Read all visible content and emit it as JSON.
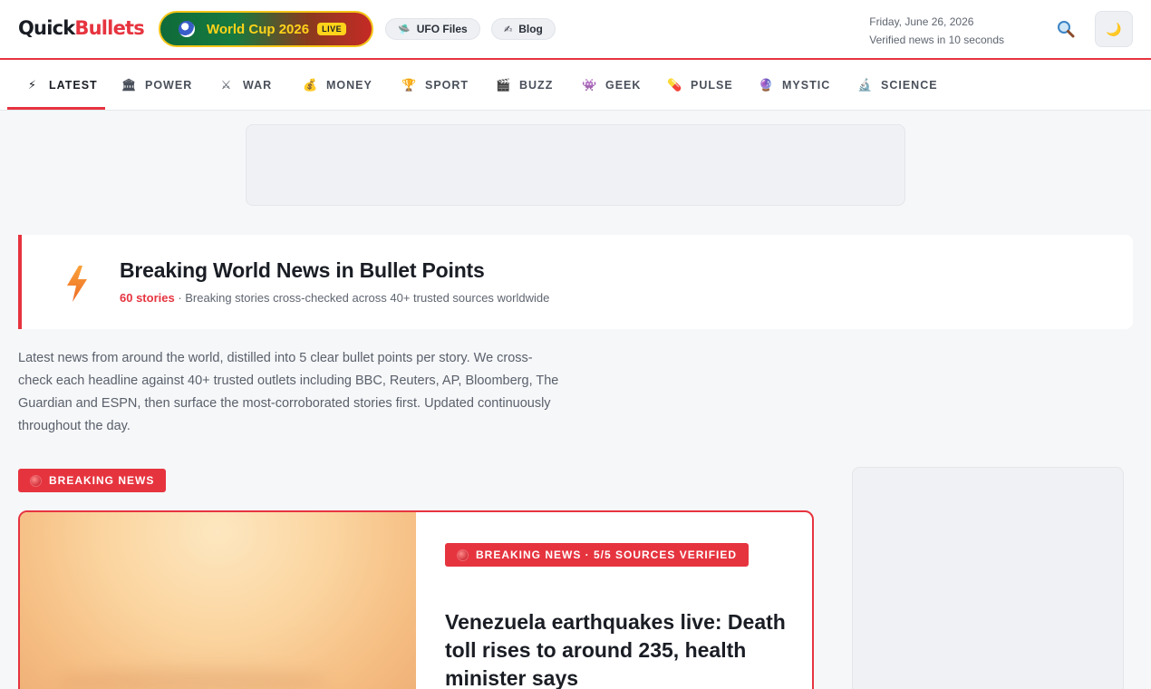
{
  "header": {
    "logo_part1": "Quick",
    "logo_part2": "Bullets",
    "world_cup": {
      "label": "World Cup 2026",
      "live": "LIVE"
    },
    "pills": [
      {
        "label": "UFO Files",
        "icon": "ufo-icon"
      },
      {
        "label": "Blog",
        "icon": "writing-hand-icon"
      }
    ],
    "date": "Friday, June 26, 2026",
    "tagline": "Verified news in 10 seconds",
    "search_icon": "search-icon",
    "theme_icon": "moon-icon"
  },
  "nav": {
    "items": [
      {
        "label": "LATEST",
        "icon": "⚡",
        "active": true
      },
      {
        "label": "POWER",
        "icon": "🏛"
      },
      {
        "label": "WAR",
        "icon": "⚔"
      },
      {
        "label": "MONEY",
        "icon": "💰"
      },
      {
        "label": "SPORT",
        "icon": "🏆"
      },
      {
        "label": "BUZZ",
        "icon": "🎬"
      },
      {
        "label": "GEEK",
        "icon": "👾"
      },
      {
        "label": "PULSE",
        "icon": "💊"
      },
      {
        "label": "MYSTIC",
        "icon": "🔮"
      },
      {
        "label": "SCIENCE",
        "icon": "🔬"
      }
    ]
  },
  "hero": {
    "title": "Breaking World News in Bullet Points",
    "count": "60 stories",
    "subtitle": " · Breaking stories cross-checked across 40+ trusted sources worldwide",
    "intro": "Latest news from around the world, distilled into 5 clear bullet points per story. We cross-check each headline against 40+ trusted outlets including BBC, Reuters, AP, Bloomberg, The Guardian and ESPN, then surface the most-corroborated stories first. Updated continuously throughout the day."
  },
  "breaking_label": "BREAKING NEWS",
  "story": {
    "badge": "BREAKING NEWS · 5/5 SOURCES VERIFIED",
    "headline": "Venezuela earthquakes live: Death toll rises to around 235, health minister says"
  },
  "colors": {
    "accent": "#e6343f",
    "gold": "#ffd31a",
    "bg": "#f6f7f9"
  }
}
